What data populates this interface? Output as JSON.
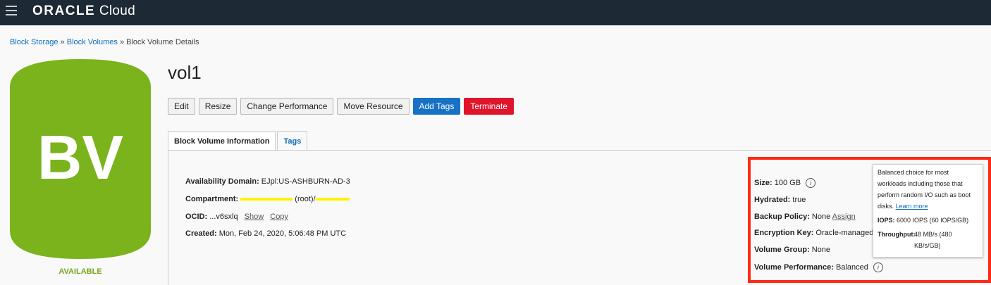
{
  "header": {
    "logo_main": "ORACLE",
    "logo_sub": "Cloud"
  },
  "breadcrumb": {
    "items": [
      "Block Storage",
      "Block Volumes"
    ],
    "current": "Block Volume Details",
    "separator": "»"
  },
  "volume_icon": {
    "text": "BV",
    "status": "AVAILABLE",
    "color": "#7ab31c"
  },
  "page_title": "vol1",
  "actions": {
    "edit": "Edit",
    "resize": "Resize",
    "change_performance": "Change Performance",
    "move_resource": "Move Resource",
    "add_tags": "Add Tags",
    "terminate": "Terminate"
  },
  "tabs": {
    "info": "Block Volume Information",
    "tags": "Tags"
  },
  "details": {
    "availability_domain_label": "Availability Domain:",
    "availability_domain": "EJpl:US-ASHBURN-AD-3",
    "compartment_label": "Compartment:",
    "compartment": "(root)/",
    "ocid_label": "OCID:",
    "ocid": "...v6sxlq",
    "show": "Show",
    "copy": "Copy",
    "created_label": "Created:",
    "created": "Mon, Feb 24, 2020, 5:06:48 PM UTC"
  },
  "right_details": {
    "size_label": "Size:",
    "size": "100 GB",
    "hydrated_label": "Hydrated:",
    "hydrated": "true",
    "backup_label": "Backup Policy:",
    "backup": "None",
    "assign": "Assign",
    "encryption_label": "Encryption Key:",
    "encryption": "Oracle-managed",
    "group_label": "Volume Group:",
    "group": "None",
    "perf_label": "Volume Performance:",
    "perf": "Balanced"
  },
  "tooltip": {
    "description": "Balanced choice for most workloads including those that perform random I/O such as boot disks.",
    "learn_more": "Learn more",
    "iops_label": "IOPS:",
    "iops": "6000 IOPS (60 IOPS/GB)",
    "throughput_label": "Throughput:",
    "throughput": "48 MB/s (480 KB/s/GB)"
  },
  "icons": {
    "menu": "hamburger-menu-icon",
    "info": "info-icon"
  },
  "colors": {
    "header_bg": "#1d2a35",
    "primary": "#1772c6",
    "danger": "#e0142b",
    "highlight_box": "#ff2a14"
  }
}
